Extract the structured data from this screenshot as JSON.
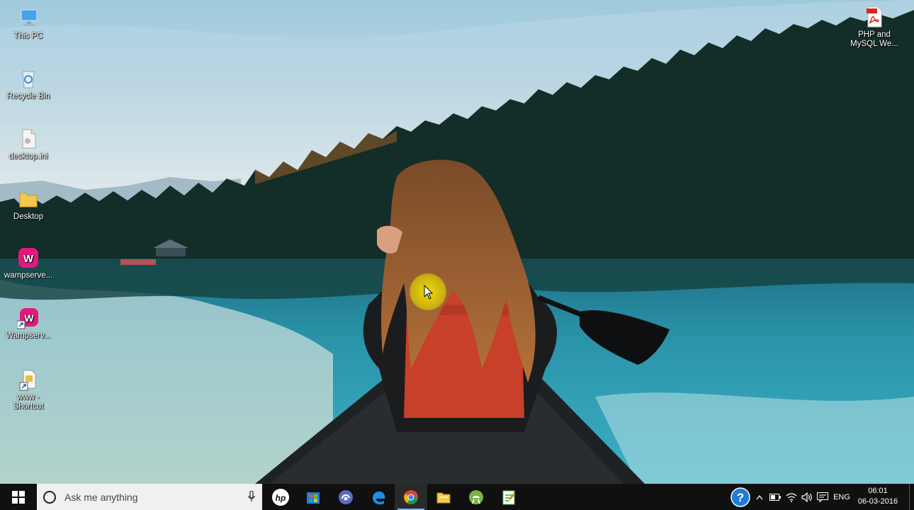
{
  "desktop_icons": [
    {
      "id": "this-pc",
      "label": "This PC",
      "icon": "computer-icon"
    },
    {
      "id": "recycle-bin",
      "label": "Recycle Bin",
      "icon": "recycle-bin-icon"
    },
    {
      "id": "desktop-ini",
      "label": "desktop.ini",
      "icon": "file-icon"
    },
    {
      "id": "desktop-folder",
      "label": "Desktop",
      "icon": "folder-icon"
    },
    {
      "id": "wampserver-1",
      "label": "wampserve...",
      "icon": "wampserver-icon"
    },
    {
      "id": "wampserver-2",
      "label": "Wampserv...",
      "icon": "wampserver-shortcut-icon"
    },
    {
      "id": "www-shortcut",
      "label": "www -\nShortcut",
      "icon": "shortcut-file-icon"
    },
    {
      "id": "php-pdf",
      "label": "PHP and\nMySQL We...",
      "icon": "pdf-icon"
    }
  ],
  "taskbar": {
    "search_placeholder": "Ask me anything",
    "apps": [
      {
        "name": "hp",
        "icon": "hp-icon"
      },
      {
        "name": "windows-store",
        "icon": "store-icon"
      },
      {
        "name": "torrent",
        "icon": "torrent-icon"
      },
      {
        "name": "edge",
        "icon": "edge-icon"
      },
      {
        "name": "chrome",
        "icon": "chrome-icon",
        "active": true
      },
      {
        "name": "file-explorer",
        "icon": "folder-icon"
      },
      {
        "name": "android-studio",
        "icon": "android-icon"
      },
      {
        "name": "notepad-plus-plus",
        "icon": "notepad-icon"
      }
    ],
    "tray": {
      "language": "ENG",
      "time": "06:01",
      "date": "06-03-2016"
    }
  },
  "colors": {
    "taskbar_bg": "#101010",
    "active_indicator": "#78b8f0",
    "cursor_highlight": "#f0e800"
  }
}
